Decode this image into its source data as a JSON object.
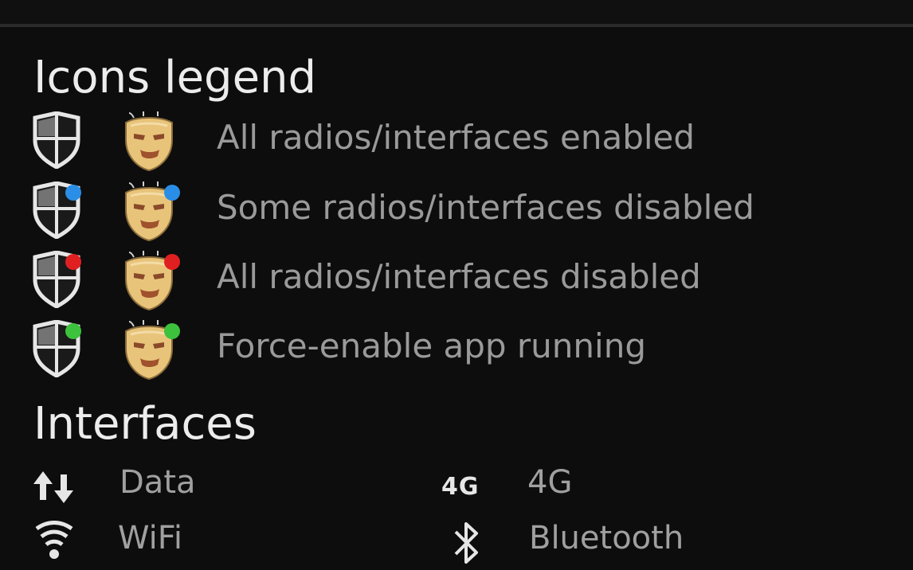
{
  "sections": {
    "legend_title": "Icons legend",
    "interfaces_title": "Interfaces"
  },
  "legend": [
    {
      "label": "All radios/interfaces enabled",
      "status": "enabled",
      "dot_color": null
    },
    {
      "label": "Some radios/interfaces disabled",
      "status": "partial",
      "dot_color": "#2a8ee6"
    },
    {
      "label": "All radios/interfaces disabled",
      "status": "disabled",
      "dot_color": "#e02020"
    },
    {
      "label": "Force-enable app running",
      "status": "forced",
      "dot_color": "#3cc23c"
    }
  ],
  "interfaces": [
    {
      "label": "Data",
      "icon": "data-arrows-icon"
    },
    {
      "label": "4G",
      "icon": "4g-icon",
      "badge": "4G"
    },
    {
      "label": "WiFi",
      "icon": "wifi-icon"
    },
    {
      "label": "Bluetooth",
      "icon": "bluetooth-icon"
    }
  ],
  "colors": {
    "background": "#0d0d0d",
    "title_text": "#ececec",
    "label_text": "#9a9a9a",
    "mask_gold": "#e8c47a",
    "shield_white": "#e6e6e6"
  }
}
